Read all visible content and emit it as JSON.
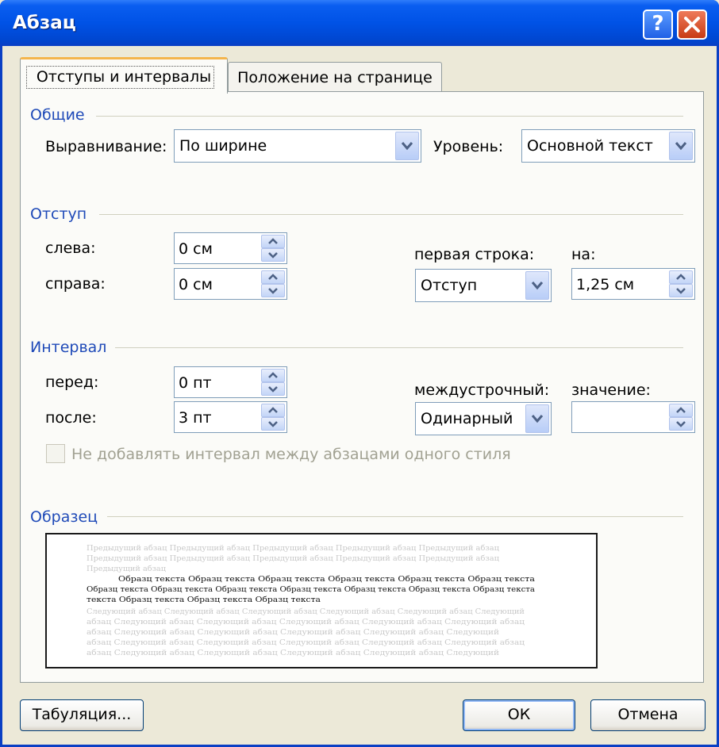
{
  "window": {
    "title": "Абзац",
    "help_glyph": "?",
    "close_glyph": "✕"
  },
  "tabs": [
    {
      "label": "Отступы и интервалы",
      "active": true
    },
    {
      "label": "Положение на странице",
      "active": false
    }
  ],
  "general": {
    "heading": "Общие",
    "alignment_label": "Выравнивание:",
    "alignment_value": "По ширине",
    "level_label": "Уровень:",
    "level_value": "Основной текст"
  },
  "indent": {
    "heading": "Отступ",
    "left_label": "слева:",
    "left_value": "0 см",
    "right_label": "справа:",
    "right_value": "0 см",
    "first_line_label": "первая строка:",
    "first_line_value": "Отступ",
    "by_label": "на:",
    "by_value": "1,25 см"
  },
  "spacing": {
    "heading": "Интервал",
    "before_label": "перед:",
    "before_value": "0 пт",
    "after_label": "после:",
    "after_value": "3 пт",
    "line_label": "междустрочный:",
    "line_value": "Одинарный",
    "at_label": "значение:",
    "at_value": "",
    "no_space_label": "Не добавлять интервал между абзацами одного стиля",
    "no_space_checked": false
  },
  "preview": {
    "heading": "Образец",
    "prev_para": [
      "Предыдущий абзац Предыдущий абзац Предыдущий абзац Предыдущий абзац Предыдущий абзац",
      "Предыдущий абзац Предыдущий абзац Предыдущий абзац Предыдущий абзац Предыдущий абзац",
      "Предыдущий абзац"
    ],
    "sample_para": [
      "Образц текста Образц текста Образц текста Образц текста Образц текста Образц текста",
      "Образц текста Образц текста Образц текста Образц текста Образц текста Образц текста Образц текста",
      "текста Образц текста Образц текста Образц текста"
    ],
    "next_para": [
      "Следующий абзац Следующий абзац Следующий абзац Следующий абзац Следующий абзац Следующий",
      "абзац Следующий абзац Следующий абзац Следующий абзац Следующий абзац Следующий абзац",
      "абзац Следующий абзац Следующий абзац Следующий абзац Следующий абзац Следующий",
      "абзац Следующий абзац Следующий абзац Следующий абзац Следующий абзац Следующий абзац",
      "абзац Следующий абзац Следующий абзац Следующий абзац Следующий абзац Следующий"
    ]
  },
  "buttons": {
    "tabs": "Табуляция...",
    "ok": "ОК",
    "cancel": "Отмена"
  },
  "colors": {
    "titlebar": "#0052e6",
    "group_heading": "#1f4ab8",
    "dialog_bg": "#ece9d8"
  }
}
